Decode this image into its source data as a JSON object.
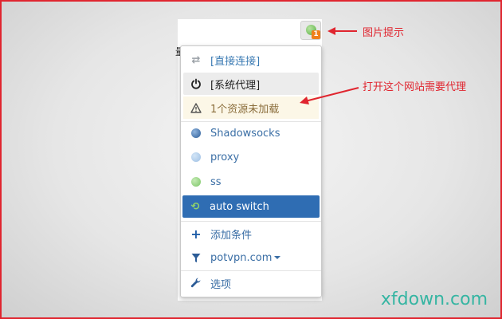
{
  "menu": {
    "direct_label": "[直接连接]",
    "system_label": "[系统代理]",
    "warning_label": "1个资源未加载",
    "profiles": [
      {
        "label": "Shadowsocks"
      },
      {
        "label": "proxy"
      },
      {
        "label": "ss"
      }
    ],
    "auto_switch_label": "auto switch",
    "add_condition_label": "添加条件",
    "domain_label": "potvpn.com",
    "options_label": "选项"
  },
  "extension": {
    "badge_count": "1"
  },
  "background_char": "量",
  "annotations": {
    "icon_hint": "图片提示",
    "proxy_hint": "打开这个网站需要代理"
  },
  "watermark": "xfdown.com",
  "colors": {
    "accent_blue": "#2f6db3",
    "annotation_red": "#e0252f",
    "warning_bg": "#fcf7e7",
    "watermark": "#35b5a2"
  }
}
